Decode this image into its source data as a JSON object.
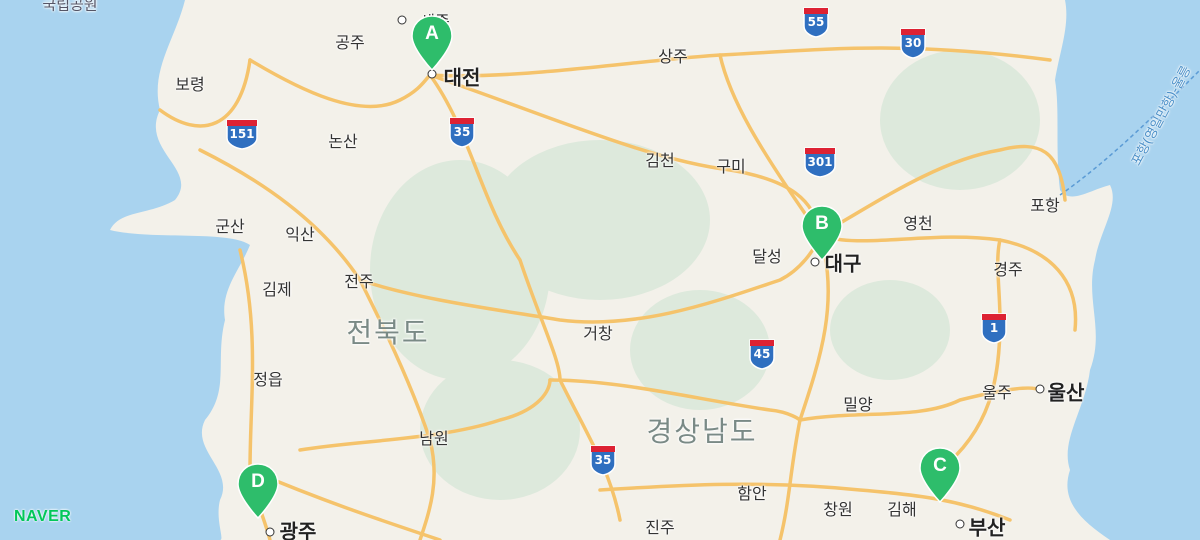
{
  "map": {
    "brand": "NAVER",
    "colors": {
      "sea": "#a9d3ef",
      "land": "#f3f1ea",
      "road": "#f5c36b",
      "marker": "#2ebd6b"
    },
    "labels": [
      {
        "text": "대전",
        "big": true
      },
      {
        "text": "세종",
        "big": false
      },
      {
        "text": "공주"
      },
      {
        "text": "보령"
      },
      {
        "text": "논산"
      },
      {
        "text": "군산"
      },
      {
        "text": "익산"
      },
      {
        "text": "전주"
      },
      {
        "text": "김제"
      },
      {
        "text": "정읍"
      },
      {
        "text": "남원"
      },
      {
        "text": "광주",
        "big": true
      },
      {
        "text": "상주"
      },
      {
        "text": "김천"
      },
      {
        "text": "구미"
      },
      {
        "text": "달성"
      },
      {
        "text": "대구",
        "big": true
      },
      {
        "text": "영천"
      },
      {
        "text": "포항"
      },
      {
        "text": "경주"
      },
      {
        "text": "거창"
      },
      {
        "text": "밀양"
      },
      {
        "text": "울주"
      },
      {
        "text": "울산",
        "big": true
      },
      {
        "text": "함안"
      },
      {
        "text": "창원"
      },
      {
        "text": "김해"
      },
      {
        "text": "부산",
        "big": true
      },
      {
        "text": "진주"
      },
      {
        "text": "국립공원"
      }
    ],
    "provinces": [
      "전북도",
      "경상남도"
    ],
    "water_labels": [
      "포항(영일만항)-울릉"
    ],
    "highways": [
      "55",
      "30",
      "151",
      "35",
      "301",
      "45",
      "1",
      "35"
    ],
    "markers": [
      {
        "letter": "A",
        "name": "대전"
      },
      {
        "letter": "B",
        "name": "대구"
      },
      {
        "letter": "C",
        "name": "부산"
      },
      {
        "letter": "D",
        "name": "광주"
      }
    ]
  }
}
